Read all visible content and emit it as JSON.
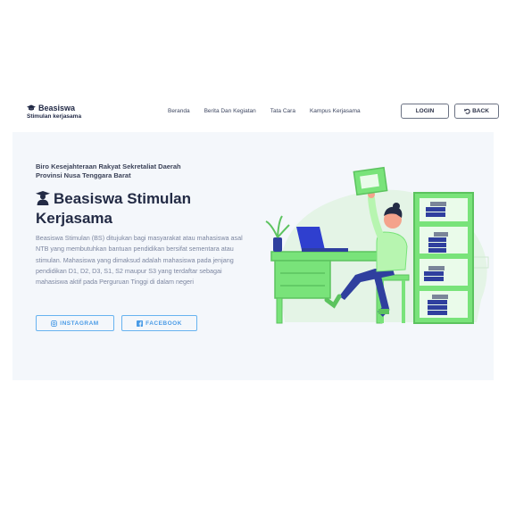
{
  "brand": {
    "title": "Beasiswa",
    "subtitle": "Stimulan kerjasama"
  },
  "nav": [
    {
      "label": "Beranda"
    },
    {
      "label": "Berita Dan Kegiatan"
    },
    {
      "label": "Tata Cara"
    },
    {
      "label": "Kampus Kerjasama"
    }
  ],
  "buttons": {
    "login": "LOGIN",
    "back": "BACK"
  },
  "hero": {
    "eyebrow_line1": "Biro Kesejahteraan Rakyat Sekretaliat Daerah",
    "eyebrow_line2": "Provinsi Nusa Tenggara Barat",
    "title_line1": "Beasiswa Stimulan",
    "title_line2": "Kerjasama",
    "description": "Beasiswa Stimulan (BS) ditujukan bagi masyarakat atau mahasiswa asal NTB yang membutuhkan bantuan pendidikan bersifat sementara atau stimulan. Mahasiswa yang dimaksud adalah mahasiswa pada jenjang pendidikan D1, D2, D3, S1, S2 maupur S3 yang terdaftar sebagai mahasiswa aktif pada Perguruan Tinggi di dalam negeri",
    "instagram": "INSTAGRAM",
    "facebook": "FACEBOOK"
  },
  "icons": {
    "brand": "graduation-cap-icon",
    "back": "undo-icon",
    "instagram": "instagram-icon",
    "facebook": "facebook-icon",
    "title": "student-icon"
  },
  "colors": {
    "accent": "#4a9be6",
    "illustration_green": "#79e37a",
    "dark": "#232b45",
    "hero_bg": "#f4f7fb"
  }
}
